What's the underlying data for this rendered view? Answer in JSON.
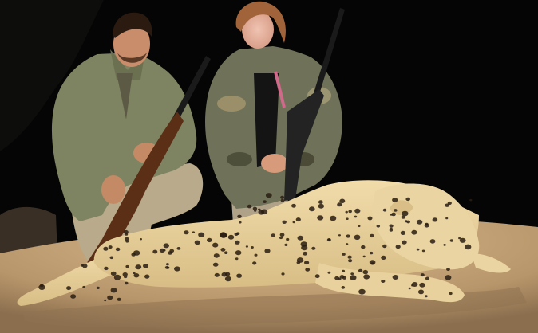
{
  "photo": {
    "colors": {
      "night_sky": "#050505",
      "ground": "#c7a67b",
      "ground_shadow": "#8f7352",
      "leopard_coat": "#e6cf98",
      "leopard_spots": "#2a1d12",
      "khaki_jacket": "#7d8260",
      "camo_jacket": "#6f7258",
      "trousers": "#b9ab8c",
      "rifle_stock": "#5b2e16",
      "rifle_metal": "#1a1a1a",
      "face_blur": "#e6b6a4"
    }
  }
}
